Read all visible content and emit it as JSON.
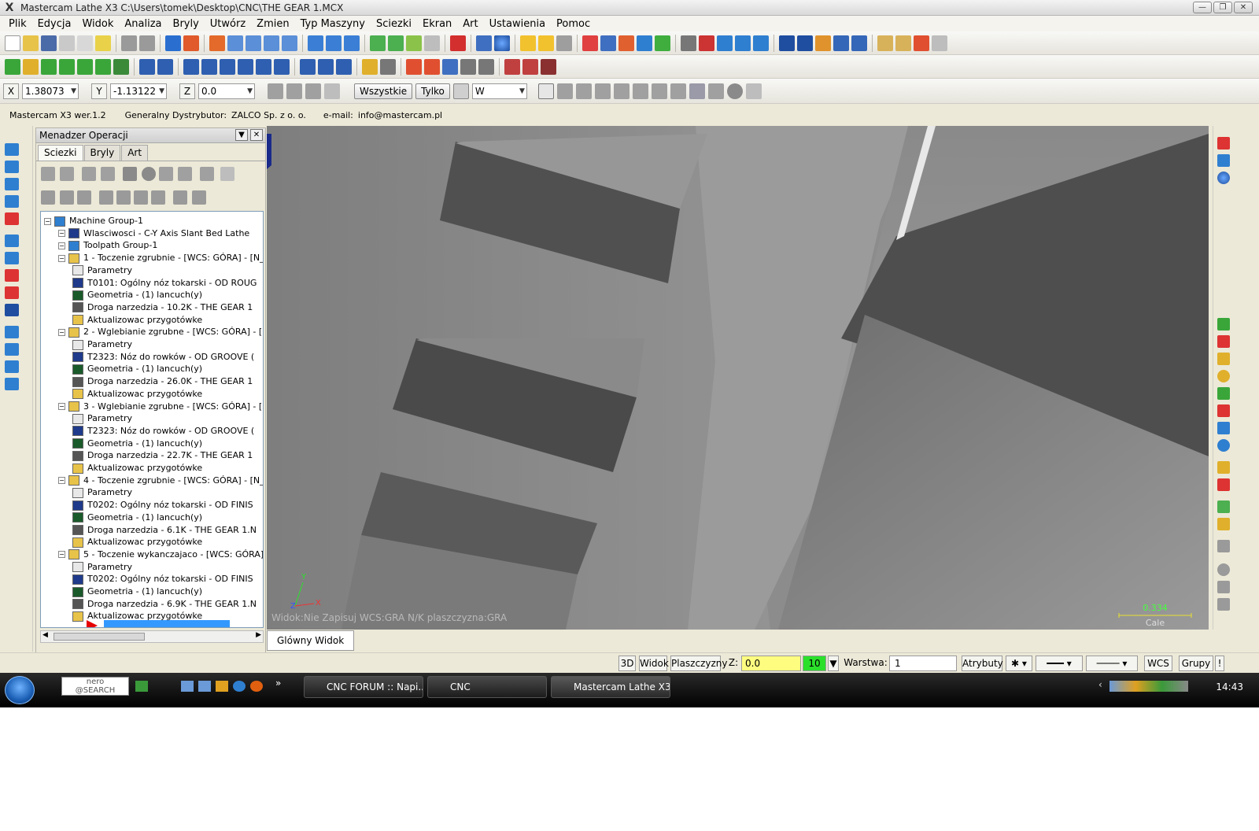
{
  "window": {
    "title": "Mastercam Lathe X3  C:\\Users\\tomek\\Desktop\\CNC\\THE GEAR 1.MCX",
    "min": "—",
    "max": "❐",
    "close": "✕"
  },
  "menu": [
    "Plik",
    "Edycja",
    "Widok",
    "Analiza",
    "Bryly",
    "Utwórz",
    "Zmien",
    "Typ Maszyny",
    "Sciezki",
    "Ekran",
    "Art",
    "Ustawienia",
    "Pomoc"
  ],
  "coords": {
    "x_label": "X",
    "x_value": "1.38073",
    "y_label": "Y",
    "y_value": "-1.13122",
    "z_label": "Z",
    "z_value": "0.0",
    "all_button": "Wszystkie",
    "only_button": "Tylko",
    "select_value": "W"
  },
  "info": {
    "version": "Mastercam X3 wer.1.2",
    "distributor_label": "Generalny Dystrybutor:",
    "distributor": "ZALCO Sp. z o. o.",
    "email_label": "e-mail:",
    "email": "info@mastercam.pl"
  },
  "opmgr": {
    "title": "Menadzer Operacji",
    "tabs": [
      "Sciezki",
      "Bryly",
      "Art"
    ],
    "tree": [
      {
        "text": "Machine Group-1",
        "level": 0,
        "icon": "machine-group-icon"
      },
      {
        "text": "Wlasciwosci - C-Y Axis Slant Bed Lathe",
        "level": 1,
        "icon": "properties-icon"
      },
      {
        "text": "Toolpath Group-1",
        "level": 1,
        "icon": "toolpath-group-icon"
      },
      {
        "text": "1 - Toczenie zgrubnie - [WCS: GÓRA] - [N_",
        "level": 2,
        "icon": "folder-icon"
      },
      {
        "text": "Parametry",
        "level": 3,
        "icon": "parameters-icon"
      },
      {
        "text": "T0101: Ogólny nóz tokarski - OD ROUG",
        "level": 3,
        "icon": "tool-icon"
      },
      {
        "text": "Geometria - (1) lancuch(y)",
        "level": 3,
        "icon": "geometry-icon"
      },
      {
        "text": "Droga narzedzia - 10.2K - THE GEAR 1",
        "level": 3,
        "icon": "toolpath-icon"
      },
      {
        "text": "Aktualizowac przygotówke",
        "level": 3,
        "icon": "stock-icon"
      },
      {
        "text": "2 - Wglebianie zgrubne - [WCS: GÓRA] - [I",
        "level": 2,
        "icon": "folder-icon"
      },
      {
        "text": "Parametry",
        "level": 3,
        "icon": "parameters-icon"
      },
      {
        "text": "T2323: Nóz do rowków - OD GROOVE (",
        "level": 3,
        "icon": "tool-icon"
      },
      {
        "text": "Geometria - (1) lancuch(y)",
        "level": 3,
        "icon": "geometry-icon"
      },
      {
        "text": "Droga narzedzia - 26.0K - THE GEAR 1",
        "level": 3,
        "icon": "toolpath-icon"
      },
      {
        "text": "Aktualizowac przygotówke",
        "level": 3,
        "icon": "stock-icon"
      },
      {
        "text": "3 - Wglebianie zgrubne - [WCS: GÓRA] - [I",
        "level": 2,
        "icon": "folder-icon"
      },
      {
        "text": "Parametry",
        "level": 3,
        "icon": "parameters-icon"
      },
      {
        "text": "T2323: Nóz do rowków - OD GROOVE (",
        "level": 3,
        "icon": "tool-icon"
      },
      {
        "text": "Geometria - (1) lancuch(y)",
        "level": 3,
        "icon": "geometry-icon"
      },
      {
        "text": "Droga narzedzia - 22.7K - THE GEAR 1",
        "level": 3,
        "icon": "toolpath-icon"
      },
      {
        "text": "Aktualizowac przygotówke",
        "level": 3,
        "icon": "stock-icon"
      },
      {
        "text": "4 - Toczenie zgrubnie - [WCS: GÓRA] - [N_",
        "level": 2,
        "icon": "folder-icon"
      },
      {
        "text": "Parametry",
        "level": 3,
        "icon": "parameters-icon"
      },
      {
        "text": "T0202: Ogólny nóz tokarski - OD FINIS",
        "level": 3,
        "icon": "tool-icon"
      },
      {
        "text": "Geometria - (1) lancuch(y)",
        "level": 3,
        "icon": "geometry-icon"
      },
      {
        "text": "Droga narzedzia - 6.1K - THE GEAR 1.N",
        "level": 3,
        "icon": "toolpath-icon"
      },
      {
        "text": "Aktualizowac przygotówke",
        "level": 3,
        "icon": "stock-icon"
      },
      {
        "text": "5 - Toczenie wykanczajaco - [WCS: GÓRA]",
        "level": 2,
        "icon": "folder-icon"
      },
      {
        "text": "Parametry",
        "level": 3,
        "icon": "parameters-icon"
      },
      {
        "text": "T0202: Ogólny nóz tokarski - OD FINIS",
        "level": 3,
        "icon": "tool-icon"
      },
      {
        "text": "Geometria - (1) lancuch(y)",
        "level": 3,
        "icon": "geometry-icon"
      },
      {
        "text": "Droga narzedzia - 6.9K - THE GEAR 1.N",
        "level": 3,
        "icon": "toolpath-icon"
      },
      {
        "text": "Aktualizowac przygotówke",
        "level": 3,
        "icon": "stock-icon"
      }
    ]
  },
  "viewport": {
    "status": "Widok:Nie Zapisuj   WCS:GRA   N/K plaszczyzna:GRA",
    "axis_y": "Y",
    "axis_x": "X",
    "axis_z": "Z",
    "scale_value": "0.334",
    "scale_unit": "Cale",
    "view_tab": "Glówny Widok"
  },
  "statusbar": {
    "mode_3d": "3D",
    "view": "Widok",
    "planes": "Plaszczyzny",
    "z_label": "Z:",
    "z_value": "0.0",
    "color_value": "10",
    "layer_label": "Warstwa:",
    "layer_value": "1",
    "attributes": "Atrybuty",
    "wcs": "WCS",
    "groups": "Grupy",
    "help": "!"
  },
  "taskbar": {
    "nero": "nero\n@SEARCH",
    "tasks": [
      "CNC FORUM :: Napi...",
      "CNC",
      "Mastercam Lathe X3..."
    ],
    "time": "14:43"
  },
  "colors": {
    "scale_value": "#46ff3e",
    "status_color": "#2be02b",
    "selection": "#3399ff",
    "arrow": "#e60000"
  }
}
